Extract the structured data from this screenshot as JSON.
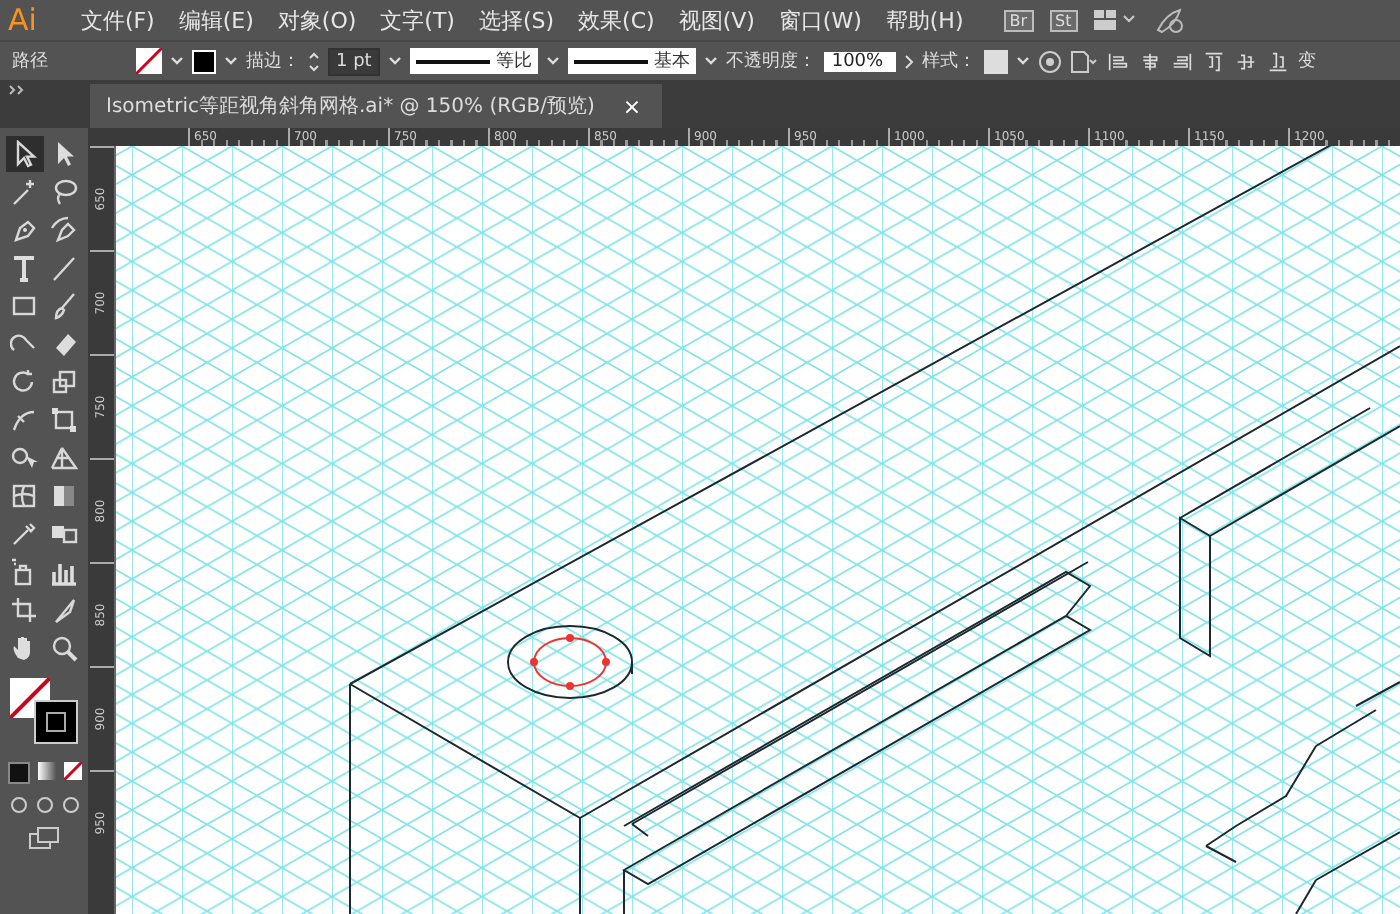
{
  "app": {
    "logo": "Ai"
  },
  "menu": [
    {
      "label": "文件(F)"
    },
    {
      "label": "编辑(E)"
    },
    {
      "label": "对象(O)"
    },
    {
      "label": "文字(T)"
    },
    {
      "label": "选择(S)"
    },
    {
      "label": "效果(C)"
    },
    {
      "label": "视图(V)"
    },
    {
      "label": "窗口(W)"
    },
    {
      "label": "帮助(H)"
    }
  ],
  "menubar_extras": [
    {
      "label": "Br"
    },
    {
      "label": "St"
    }
  ],
  "control_bar": {
    "object_type": "路径",
    "stroke_label": "描边：",
    "stroke_weight": "1 pt",
    "profile": "等比",
    "brush": "基本",
    "opacity_label": "不透明度：",
    "opacity": "100%",
    "style_label": "样式：",
    "transform": "变"
  },
  "document_tab": {
    "title": "Isometric等距视角斜角网格.ai* @ 150% (RGB/预览)",
    "close": "×"
  },
  "tools": [
    {
      "kind": "selection",
      "selected": true
    },
    {
      "kind": "direct",
      "selected": false
    },
    {
      "kind": "wand",
      "selected": false
    },
    {
      "kind": "lasso",
      "selected": false
    },
    {
      "kind": "pen",
      "selected": false
    },
    {
      "kind": "curvature",
      "selected": false
    },
    {
      "kind": "type",
      "selected": false
    },
    {
      "kind": "line",
      "selected": false
    },
    {
      "kind": "rectangle",
      "selected": false
    },
    {
      "kind": "brush",
      "selected": false
    },
    {
      "kind": "shaper",
      "selected": false
    },
    {
      "kind": "eraser",
      "selected": false
    },
    {
      "kind": "rotate",
      "selected": false
    },
    {
      "kind": "scale",
      "selected": false
    },
    {
      "kind": "width",
      "selected": false
    },
    {
      "kind": "transform",
      "selected": false
    },
    {
      "kind": "builder",
      "selected": false
    },
    {
      "kind": "perspective",
      "selected": false
    },
    {
      "kind": "mesh",
      "selected": false
    },
    {
      "kind": "gradient",
      "selected": false
    },
    {
      "kind": "eyedropper",
      "selected": false
    },
    {
      "kind": "blend",
      "selected": false
    },
    {
      "kind": "sprayer",
      "selected": false
    },
    {
      "kind": "graph",
      "selected": false
    },
    {
      "kind": "artboard",
      "selected": false
    },
    {
      "kind": "slice",
      "selected": false
    },
    {
      "kind": "hand",
      "selected": false
    },
    {
      "kind": "zoom",
      "selected": false
    }
  ],
  "ruler_h": [
    "650",
    "700",
    "750",
    "800",
    "850",
    "900",
    "950",
    "1000",
    "1050",
    "1100",
    "1150",
    "1200"
  ],
  "ruler_v": [
    "650",
    "700",
    "750",
    "800",
    "850",
    "900",
    "950"
  ]
}
